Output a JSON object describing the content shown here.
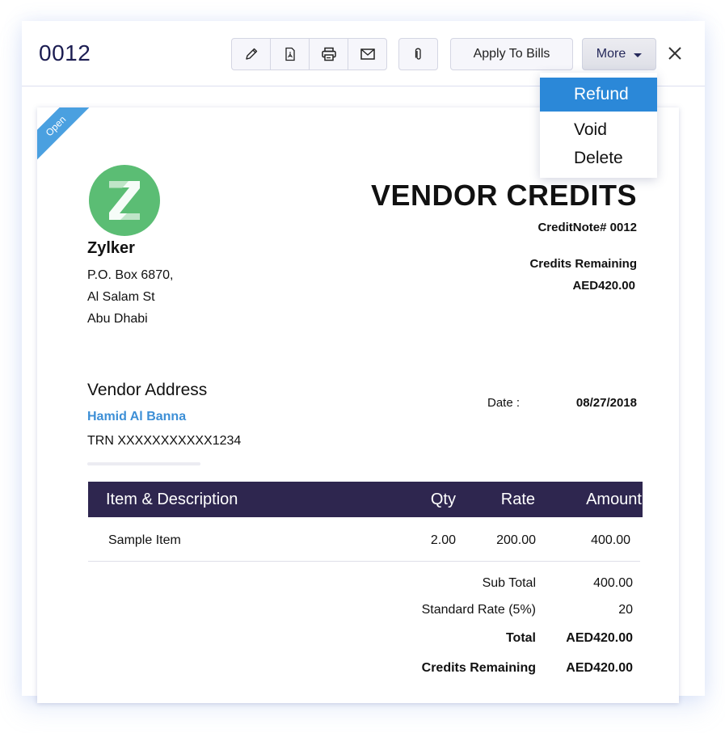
{
  "header": {
    "doc_number": "0012",
    "toolbar": {
      "icons": [
        "edit-icon",
        "pdf-icon",
        "print-icon",
        "email-icon"
      ],
      "attach_icon": "paperclip-icon",
      "apply_label": "Apply To Bills",
      "more_label": "More",
      "close_icon": "close-icon"
    },
    "more_menu": {
      "items": [
        {
          "label": "Refund",
          "active": true
        },
        {
          "label": "Void",
          "active": false
        },
        {
          "label": "Delete",
          "active": false
        }
      ]
    }
  },
  "document": {
    "status_ribbon": "Open",
    "status_color": "#4aa0e0",
    "logo_letter": "Z",
    "logo_color": "#5bbd74",
    "company": {
      "name": "Zylker",
      "address": [
        "P.O. Box 6870,",
        "Al Salam St",
        "Abu Dhabi"
      ]
    },
    "title": "VENDOR CREDITS",
    "credit_note": "CreditNote# 0012",
    "credits_remaining_label": "Credits Remaining",
    "credits_remaining_value": "AED420.00",
    "vendor": {
      "heading": "Vendor Address",
      "name": "Hamid Al Banna",
      "trn": "TRN XXXXXXXXXXX1234"
    },
    "date_label": "Date :",
    "date_value": "08/27/2018",
    "table": {
      "headers": {
        "item": "Item & Description",
        "qty": "Qty",
        "rate": "Rate",
        "amount": "Amount"
      },
      "header_color": "#2e264f",
      "rows": [
        {
          "item": "Sample Item",
          "qty": "2.00",
          "rate": "200.00",
          "amount": "400.00"
        }
      ]
    },
    "totals": {
      "sub_total_label": "Sub Total",
      "sub_total_value": "400.00",
      "tax_label": "Standard Rate (5%)",
      "tax_value": "20",
      "total_label": "Total",
      "total_value": "AED420.00",
      "credits_label": "Credits Remaining",
      "credits_value": "AED420.00"
    }
  }
}
